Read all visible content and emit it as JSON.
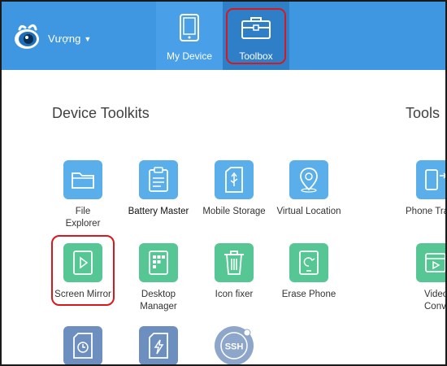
{
  "app": {
    "user_name": "Vượng",
    "tabs": [
      {
        "label": "My Device",
        "icon": "tablet-icon",
        "selected": false
      },
      {
        "label": "Toolbox",
        "icon": "briefcase-icon",
        "selected": true
      }
    ]
  },
  "sections": {
    "device_toolkits": "Device Toolkits",
    "tools": "Tools"
  },
  "device_toolkits": [
    {
      "label": "File\nExplorer",
      "icon": "folder-icon"
    },
    {
      "label": "Battery Master",
      "icon": "clipboard-icon"
    },
    {
      "label": "Mobile Storage",
      "icon": "usb-storage-icon"
    },
    {
      "label": "Virtual Location",
      "icon": "location-pin-icon"
    },
    {
      "label": "Screen Mirror",
      "icon": "play-screen-icon"
    },
    {
      "label": "Desktop\nManager",
      "icon": "grid-phone-icon"
    },
    {
      "label": "Icon fixer",
      "icon": "trash-icon"
    },
    {
      "label": "Erase Phone",
      "icon": "erase-phone-icon"
    },
    {
      "label": "",
      "icon": "clock-file-icon"
    },
    {
      "label": "",
      "icon": "flash-file-icon"
    },
    {
      "label": "",
      "icon": "ssh-icon",
      "badge": "SSH"
    }
  ],
  "tools": [
    {
      "label": "Phone Tra",
      "icon": "phone-transfer-icon"
    },
    {
      "label": "Video\nConver",
      "icon": "video-convert-icon"
    }
  ],
  "colors": {
    "header": "#3f97e2",
    "tab_selected": "#2e7fc7",
    "tile_blue": "#5aaeea",
    "tile_green": "#56c694",
    "highlight_ring": "#d8181f"
  }
}
